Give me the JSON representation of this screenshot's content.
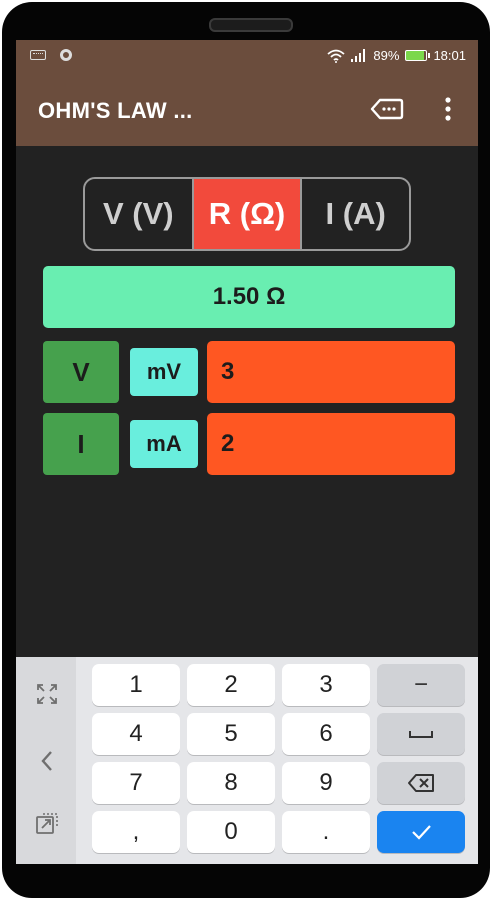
{
  "status_bar": {
    "battery_percent": "89%",
    "time": "18:01",
    "icons": [
      "keyboard-icon",
      "record-icon",
      "wifi-icon",
      "signal-icon",
      "battery-icon"
    ]
  },
  "app_bar": {
    "title": "OHM'S LAW ...",
    "actions": [
      "label-icon",
      "more-vert-icon"
    ]
  },
  "mode_selector": {
    "options": [
      "V (V)",
      "R (Ω)",
      "I (A)"
    ],
    "selected": "R (Ω)"
  },
  "result": {
    "text": "1.50 Ω"
  },
  "inputs": [
    {
      "variable": "V",
      "unit": "mV",
      "value": "3"
    },
    {
      "variable": "I",
      "unit": "mA",
      "value": "2"
    }
  ],
  "keyboard": {
    "rows": [
      [
        "1",
        "2",
        "3",
        "−"
      ],
      [
        "4",
        "5",
        "6",
        "⎵"
      ],
      [
        "7",
        "8",
        "9",
        "⌫"
      ],
      [
        ",",
        "0",
        ".",
        "✓"
      ]
    ],
    "side_icons": [
      "fullscreen-icon",
      "chevron-left-icon",
      "float-keyboard-icon"
    ]
  },
  "colors": {
    "app_bar": "#6b4d3d",
    "selected_mode": "#f24a3c",
    "result_bg": "#69eeb1",
    "variable_bg": "#46a14d",
    "unit_bg": "#69eedd",
    "value_bg": "#ff5722",
    "done_key": "#1a84f0"
  }
}
